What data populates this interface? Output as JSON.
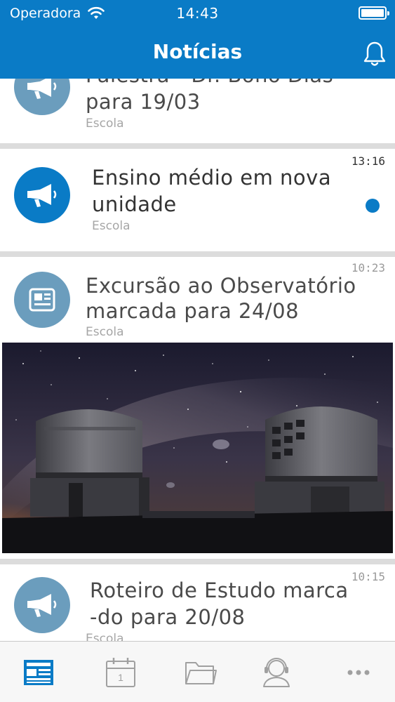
{
  "status_bar": {
    "carrier": "Operadora",
    "time": "14:43"
  },
  "nav": {
    "title": "Notícias",
    "right_icon": "bell-icon"
  },
  "feed": [
    {
      "title_line1": "Palestra - Dr. Bono Dias",
      "title_line2": "para 19/03",
      "source": "Escola",
      "icon": "megaphone-icon",
      "read": true
    },
    {
      "title_line1": "Ensino médio em nova",
      "title_line2": "unidade",
      "source": "Escola",
      "time": "13:16",
      "icon": "megaphone-icon",
      "read": false
    },
    {
      "title_line1": "Excursão ao Observatório",
      "title_line2": "marcada para 24/08",
      "source": "Escola",
      "time": "10:23",
      "icon": "newspaper-icon",
      "read": true,
      "has_image": true
    },
    {
      "title_line1": "Roteiro de Estudo marca",
      "title_line2": "-do para 20/08",
      "source": "Escola",
      "time": "10:15",
      "icon": "megaphone-icon",
      "read": true
    }
  ],
  "tab_bar": {
    "tabs": [
      {
        "icon": "news-icon",
        "selected": true
      },
      {
        "icon": "calendar-icon",
        "label": "1",
        "selected": false
      },
      {
        "icon": "folder-icon",
        "selected": false
      },
      {
        "icon": "support-icon",
        "selected": false
      },
      {
        "icon": "more-icon",
        "selected": false
      }
    ]
  },
  "colors": {
    "primary": "#0a7bc6",
    "avatar_read": "#6b9dbd",
    "separator": "#dcdcdc",
    "tab_inactive": "#a0a0a0"
  }
}
